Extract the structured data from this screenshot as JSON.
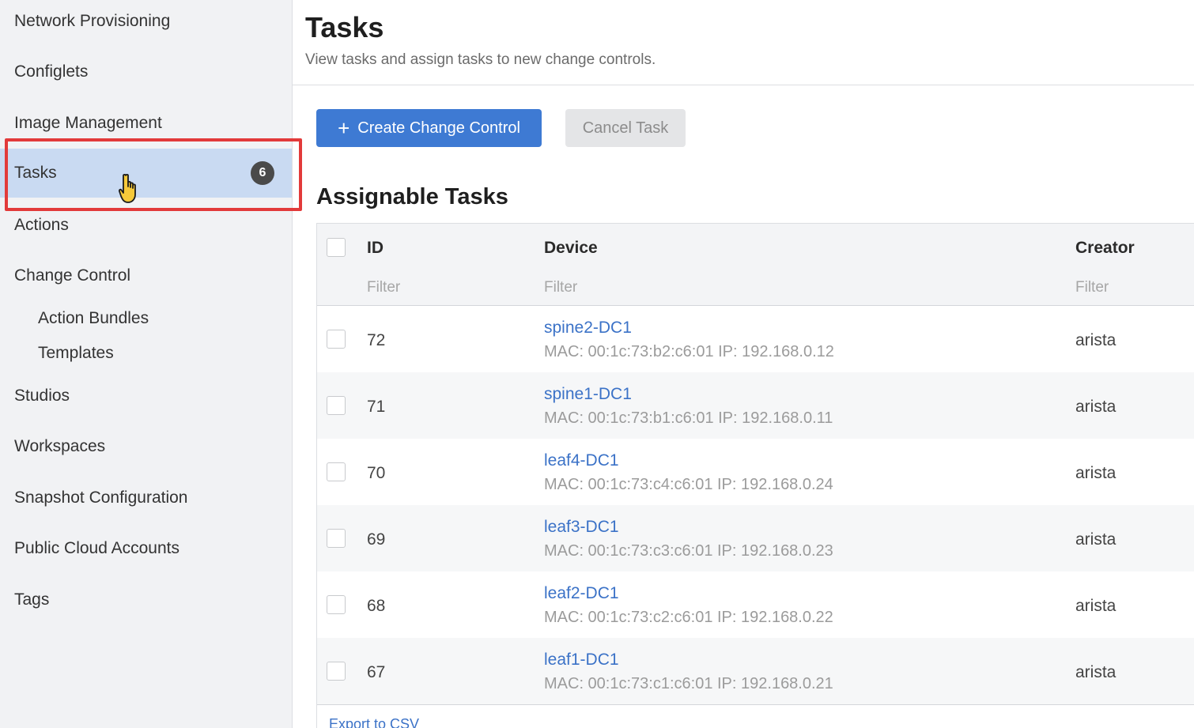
{
  "sidebar": {
    "items": [
      {
        "label": "Network Provisioning"
      },
      {
        "label": "Configlets"
      },
      {
        "label": "Image Management"
      },
      {
        "label": "Tasks",
        "badge": "6",
        "active": true
      },
      {
        "label": "Actions"
      },
      {
        "label": "Change Control"
      },
      {
        "label": "Action Bundles"
      },
      {
        "label": "Templates"
      },
      {
        "label": "Studios"
      },
      {
        "label": "Workspaces"
      },
      {
        "label": "Snapshot Configuration"
      },
      {
        "label": "Public Cloud Accounts"
      },
      {
        "label": "Tags"
      }
    ]
  },
  "header": {
    "title": "Tasks",
    "subtitle": "View tasks and assign tasks to new change controls."
  },
  "toolbar": {
    "create_label": "Create Change Control",
    "create_icon": "plus-icon",
    "cancel_label": "Cancel Task"
  },
  "section": {
    "title": "Assignable Tasks"
  },
  "table": {
    "columns": [
      {
        "label": "ID",
        "filter_placeholder": "Filter"
      },
      {
        "label": "Device",
        "filter_placeholder": "Filter"
      },
      {
        "label": "Creator",
        "filter_placeholder": "Filter"
      }
    ],
    "rows": [
      {
        "id": "72",
        "device": "spine2-DC1",
        "info": "MAC: 00:1c:73:b2:c6:01 IP: 192.168.0.12",
        "creator": "arista"
      },
      {
        "id": "71",
        "device": "spine1-DC1",
        "info": "MAC: 00:1c:73:b1:c6:01 IP: 192.168.0.11",
        "creator": "arista"
      },
      {
        "id": "70",
        "device": "leaf4-DC1",
        "info": "MAC: 00:1c:73:c4:c6:01 IP: 192.168.0.24",
        "creator": "arista"
      },
      {
        "id": "69",
        "device": "leaf3-DC1",
        "info": "MAC: 00:1c:73:c3:c6:01 IP: 192.168.0.23",
        "creator": "arista"
      },
      {
        "id": "68",
        "device": "leaf2-DC1",
        "info": "MAC: 00:1c:73:c2:c6:01 IP: 192.168.0.22",
        "creator": "arista"
      },
      {
        "id": "67",
        "device": "leaf1-DC1",
        "info": "MAC: 00:1c:73:c1:c6:01 IP: 192.168.0.21",
        "creator": "arista"
      }
    ],
    "export_label": "Export to CSV"
  },
  "colors": {
    "accent": "#3e7ad3",
    "link": "#3b72c7",
    "active_nav": "#c9daf2",
    "highlight": "#e23a3a"
  }
}
